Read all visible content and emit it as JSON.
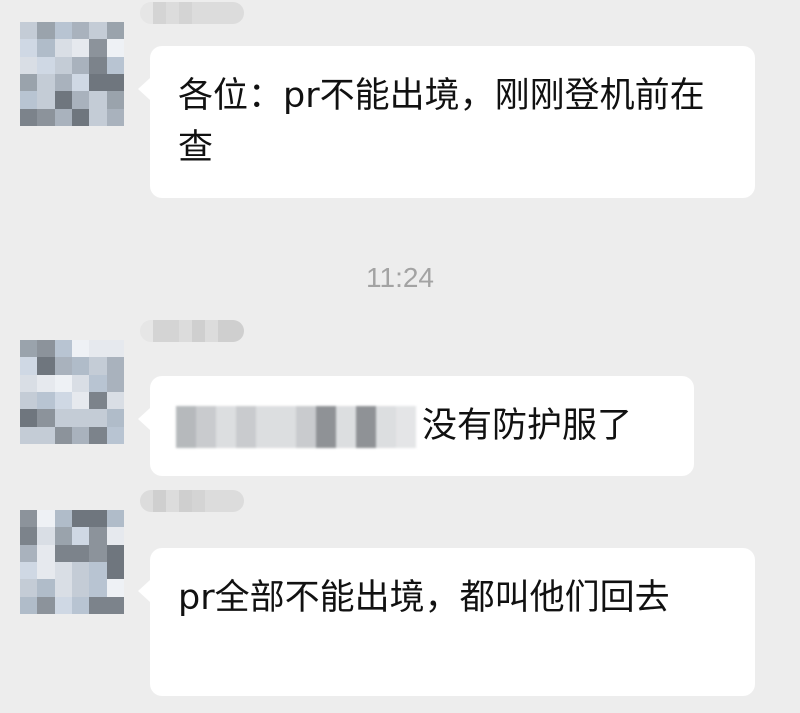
{
  "messages": [
    {
      "text": "各位：pr不能出境，刚刚登机前在查"
    },
    {
      "redacted_prefix": true,
      "text": "没有防护服了"
    },
    {
      "text": "pr全部不能出境，都叫他们回去"
    }
  ],
  "timestamp": "11:24",
  "colors": {
    "background": "#ededed",
    "bubble": "#ffffff",
    "text": "#111111",
    "timestamp": "#a3a3a3"
  },
  "icons": [
    "avatar-pixelated",
    "name-redacted"
  ]
}
